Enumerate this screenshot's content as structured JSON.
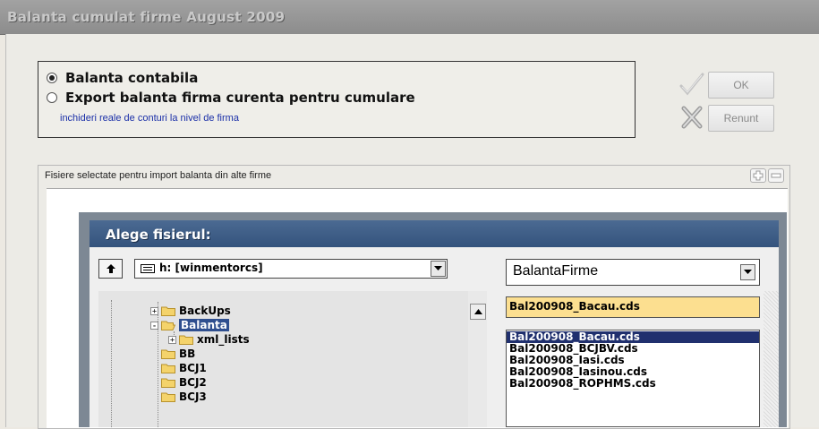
{
  "window": {
    "title": "Balanta cumulat firme August 2009"
  },
  "options": {
    "radio1_label": "Balanta contabila",
    "radio2_label": "Export balanta firma curenta pentru cumulare",
    "hint": "inchideri reale de conturi la nivel de firma",
    "selected": "radio1"
  },
  "buttons": {
    "ok": "OK",
    "cancel": "Renunt"
  },
  "files_group": {
    "title": "Fisiere selectate pentru import balanta din alte firme"
  },
  "dialog": {
    "title": "Alege fisierul:",
    "drive": "h: [winmentorcs]",
    "filter": "BalantaFirme",
    "tree": [
      {
        "name": "BackUps",
        "expander": "+",
        "level": 0
      },
      {
        "name": "Balanta",
        "expander": "-",
        "level": 0,
        "selected": true
      },
      {
        "name": "xml_lists",
        "expander": "+",
        "level": 1
      },
      {
        "name": "BB",
        "level": 0
      },
      {
        "name": "BCJ1",
        "level": 0
      },
      {
        "name": "BCJ2",
        "level": 0
      },
      {
        "name": "BCJ3",
        "level": 0
      }
    ],
    "file_input": "Bal200908_Bacau.cds",
    "files": [
      "Bal200908_Bacau.cds",
      "Bal200908_BCJBV.cds",
      "Bal200908_Iasi.cds",
      "Bal200908_Iasinou.cds",
      "Bal200908_ROPHMS.cds"
    ],
    "selected_file": 0
  },
  "colors": {
    "dialog_header": "#34537d",
    "selection": "#20306e",
    "file_input_bg": "#fcdf90",
    "hint_text": "#1a2fa8"
  }
}
